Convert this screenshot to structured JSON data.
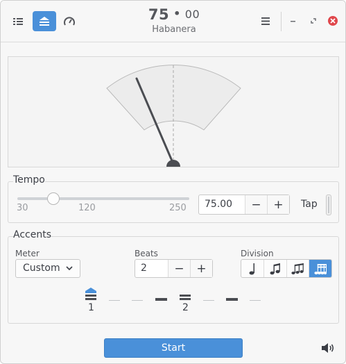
{
  "header": {
    "tempo_main": "75",
    "tempo_dot": "•",
    "tempo_fraction": "00",
    "preset_name": "Habanera",
    "icons": [
      "list-icon",
      "metronome-icon",
      "speedometer-icon",
      "hamburger-menu-icon",
      "minimize-icon",
      "restore-icon",
      "close-icon"
    ]
  },
  "gauge": {
    "needle_position": 0.35
  },
  "tempo": {
    "section_label": "Tempo",
    "slider_ticks": [
      "30",
      "120",
      "250"
    ],
    "slider_value": 75,
    "slider_range": [
      30,
      250
    ],
    "value": "75.00",
    "minus_label": "−",
    "plus_label": "+",
    "tap_label": "Tap"
  },
  "accents": {
    "section_label": "Accents",
    "meter_label": "Meter",
    "meter_value": "Custom",
    "beats_label": "Beats",
    "beats_value": "2",
    "minus_label": "−",
    "plus_label": "+",
    "division_label": "Division",
    "divisions": [
      "quarter-note-icon",
      "eighth-notes-icon",
      "triplet-icon",
      "sixteenth-notes-icon"
    ],
    "selected_division": "sixteenth-notes-icon",
    "beat_numbers": [
      "1",
      "2"
    ]
  },
  "footer": {
    "start_label": "Start",
    "volume_icon": "volume-icon"
  },
  "colors": {
    "accent": "#4a90d9",
    "close": "#e0474c",
    "needle": "#4b4d52"
  }
}
